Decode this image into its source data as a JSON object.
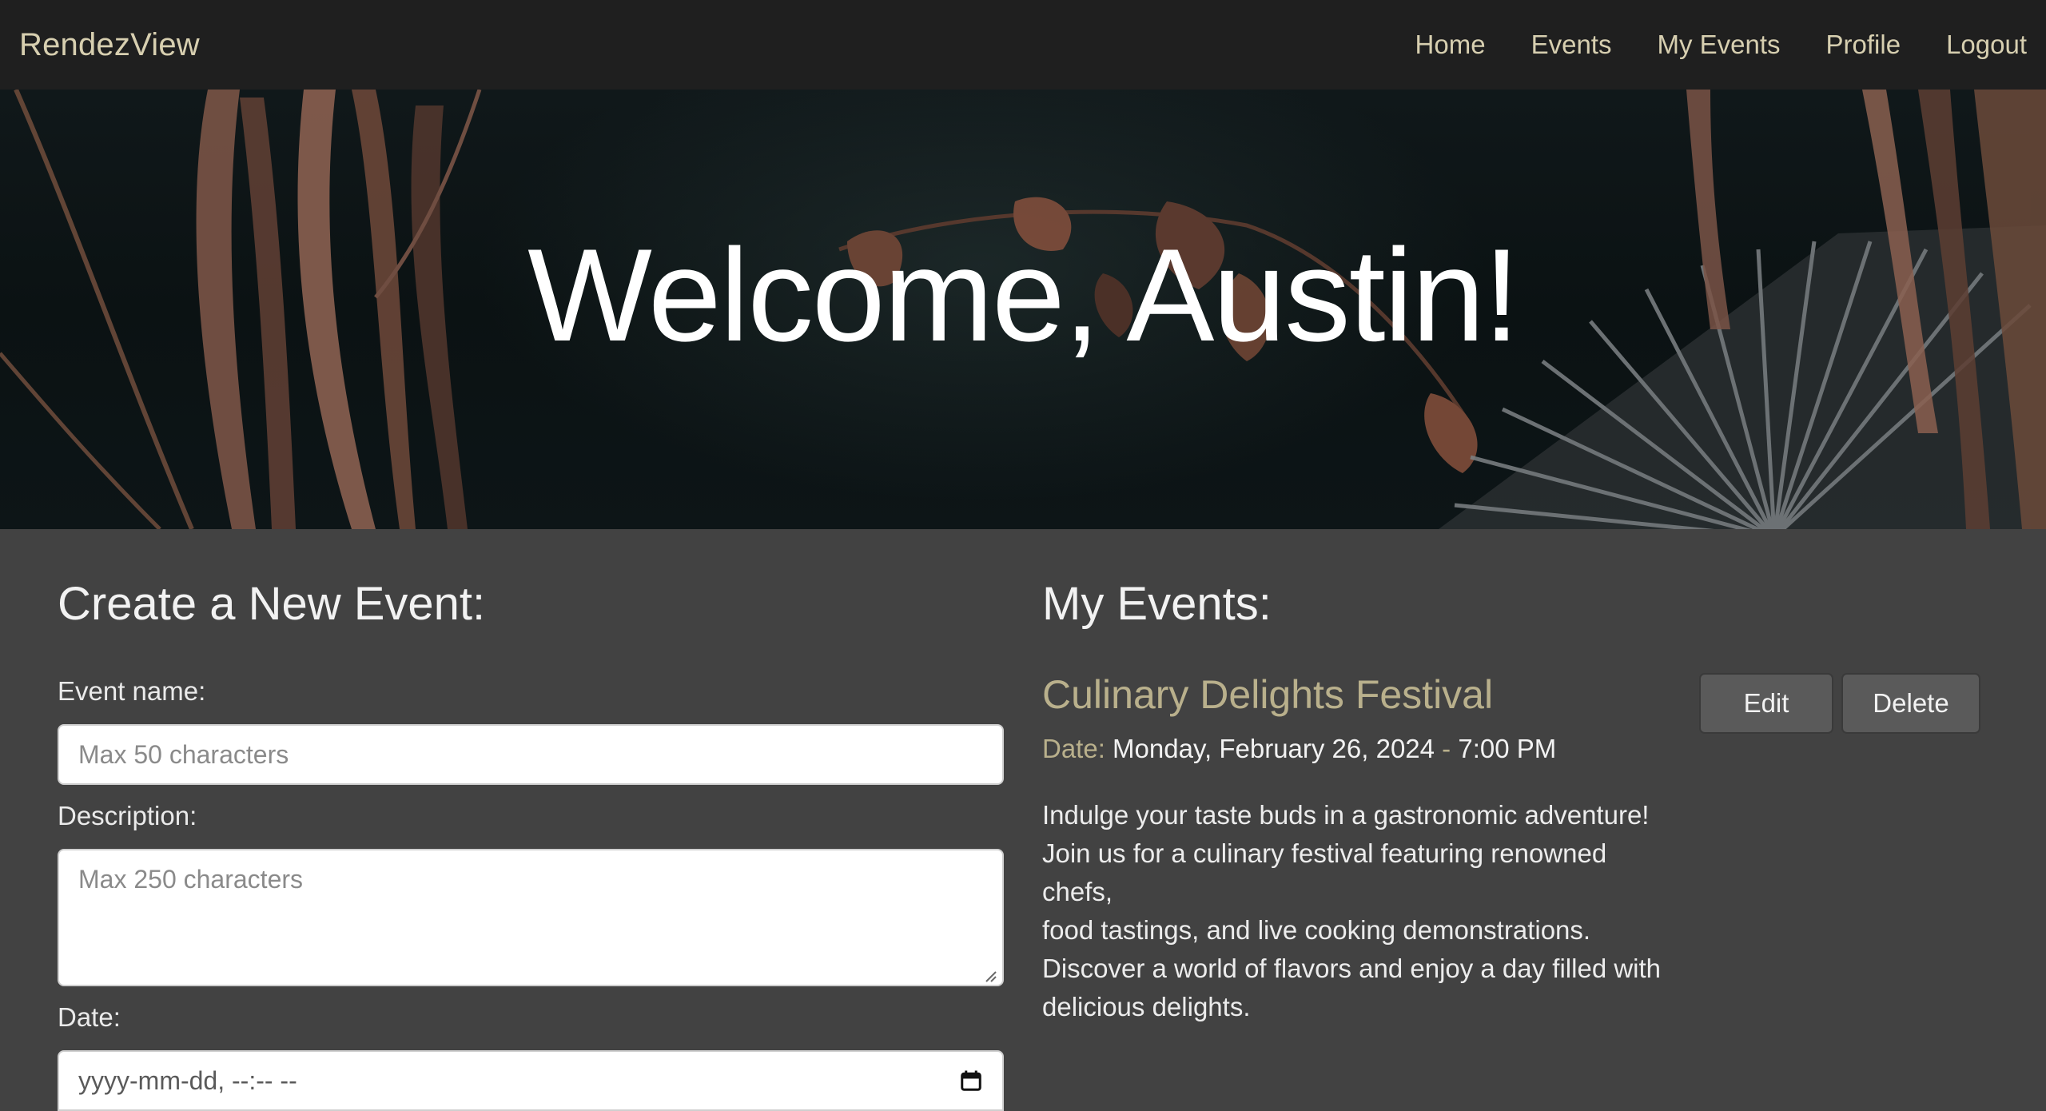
{
  "brand": "RendezView",
  "nav": {
    "items": [
      {
        "label": "Home"
      },
      {
        "label": "Events"
      },
      {
        "label": "My Events"
      },
      {
        "label": "Profile"
      },
      {
        "label": "Logout"
      }
    ]
  },
  "hero": {
    "title": "Welcome, Austin!"
  },
  "create_form": {
    "heading": "Create a New Event:",
    "name_label": "Event name:",
    "name_placeholder": "Max 50 characters",
    "desc_label": "Description:",
    "desc_placeholder": "Max 250 characters",
    "date_label": "Date:",
    "date_placeholder": "yyyy-mm-dd, --:-- --"
  },
  "my_events": {
    "heading": "My Events:",
    "events": [
      {
        "title": "Culinary Delights Festival",
        "date_label": "Date:",
        "date_value": "Monday, February 26, 2024",
        "date_separator": " - ",
        "time_value": "7:00 PM",
        "description_lines": [
          "Indulge your taste buds in a gastronomic adventure!",
          "Join us for a culinary festival featuring renowned chefs,",
          "food tastings, and live cooking demonstrations.",
          "Discover a world of flavors and enjoy a day filled with",
          "delicious delights."
        ],
        "edit_label": "Edit",
        "delete_label": "Delete"
      }
    ]
  },
  "colors": {
    "navbar_bg": "#1f1f1f",
    "nav_text": "#d7cfb0",
    "page_bg": "#424242",
    "event_title": "#b9b08c",
    "button_bg": "#5a5a5a"
  },
  "icons": {
    "date_picker": "calendar-icon"
  }
}
